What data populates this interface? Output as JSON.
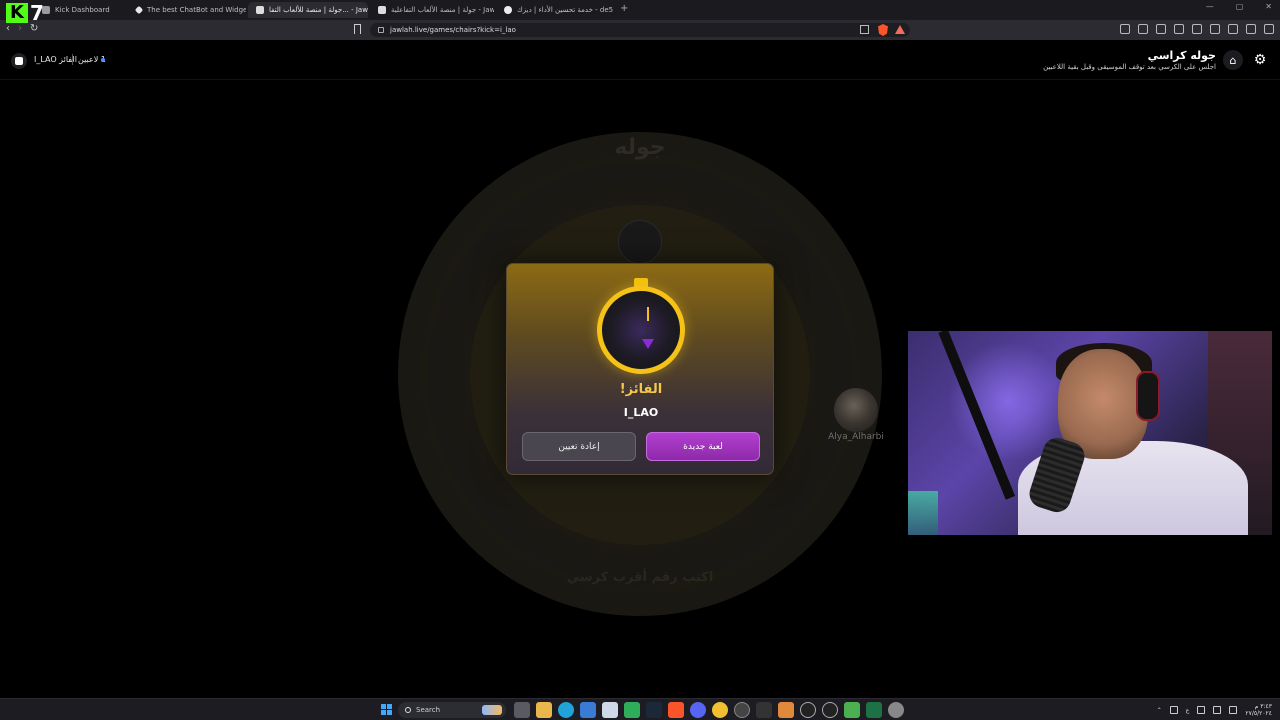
{
  "stream_overlay": {
    "logo_letter": "K",
    "logo_number": "7"
  },
  "browser": {
    "tabs": [
      {
        "title": "Kick Dashboard",
        "active": false
      },
      {
        "title": "The best ChatBot and Widgets for K...",
        "active": false
      },
      {
        "title": "جولة | منصة للألعاب التفا... - Jawlah",
        "active": true
      },
      {
        "title": "جولة | منصة الألعاب التفاعلية - Jawlah",
        "active": false
      },
      {
        "title": "خدمة تحسين الأداء | ديزك - de5",
        "active": false
      }
    ],
    "url": "jawlah.live/games/chairs?kick=i_lao",
    "new_tab_label": "+",
    "window_controls": [
      "—",
      "▢",
      "✕"
    ]
  },
  "page": {
    "header": {
      "game_title": "جوله كراسي",
      "game_subtitle": "اجلس على الكرسي بعد توقف الموسيقى وقبل بقية اللاعبين",
      "winner_label": "الفائز I_LAO",
      "players_count": "1 لاعبين"
    },
    "board": {
      "brand_text": "جوله",
      "hint_text": "اكتب رقم أقرب كرسي"
    },
    "player": {
      "name": "Alya_Alharbi"
    },
    "modal": {
      "title": "الفائز!",
      "winner_name": "I_LAO",
      "reset_button": "إعادة تعيين",
      "new_game_button": "لعبة جديدة"
    }
  },
  "taskbar": {
    "search_placeholder": "Search",
    "clock_time": "٣:٤٣ م",
    "clock_date": "٢٧/٥/٢٠٢٤",
    "language": "ع"
  },
  "colors": {
    "accent_gold": "#f5c318",
    "accent_purple": "#b23fd0",
    "kick_green": "#53fc18"
  }
}
